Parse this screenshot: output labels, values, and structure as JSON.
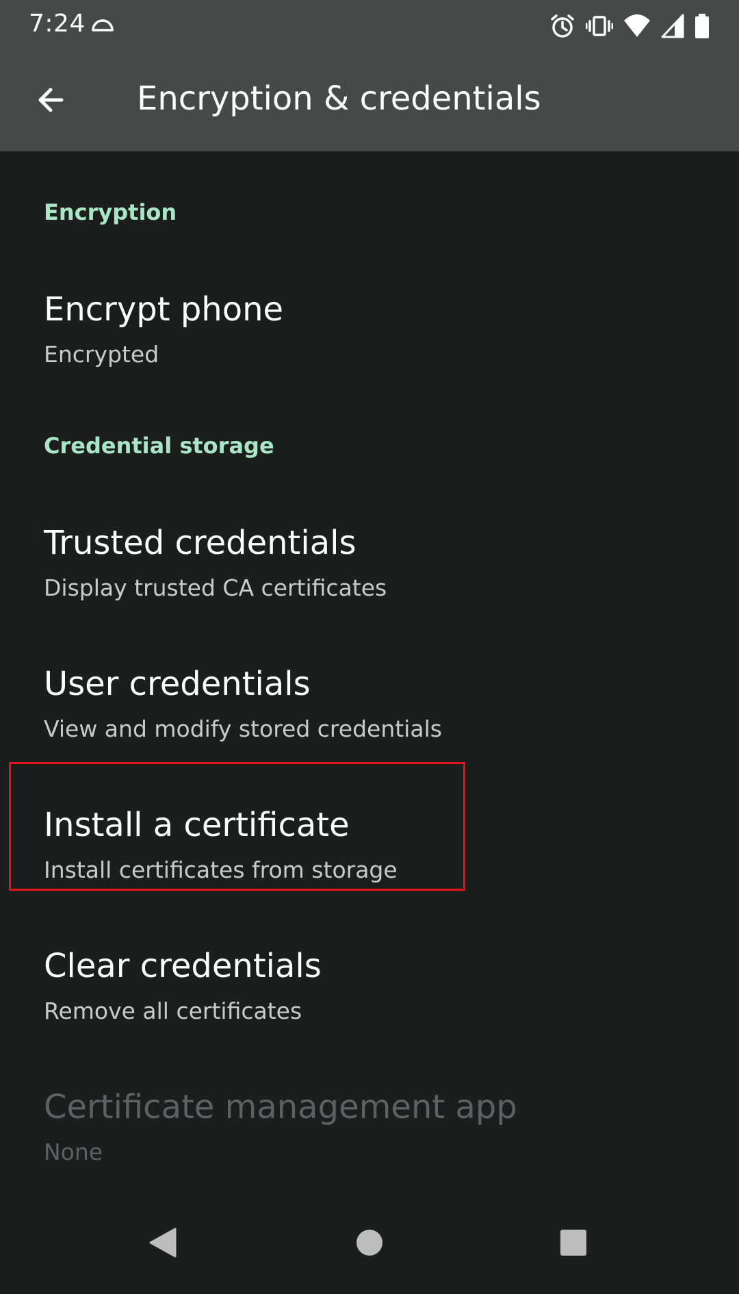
{
  "status_bar": {
    "time": "7:24",
    "icons": [
      "cloud-icon",
      "alarm-icon",
      "vibrate-icon",
      "wifi-icon",
      "signal-icon",
      "battery-icon"
    ]
  },
  "app_bar": {
    "title": "Encryption & credentials",
    "back_icon": "arrow-left-icon"
  },
  "sections": {
    "encryption": {
      "header": "Encryption",
      "items": [
        {
          "title": "Encrypt phone",
          "summary": "Encrypted"
        }
      ]
    },
    "credential_storage": {
      "header": "Credential storage",
      "items": [
        {
          "title": "Trusted credentials",
          "summary": "Display trusted CA certificates"
        },
        {
          "title": "User credentials",
          "summary": "View and modify stored credentials"
        },
        {
          "title": "Install a certificate",
          "summary": "Install certificates from storage"
        },
        {
          "title": "Clear credentials",
          "summary": "Remove all certificates"
        },
        {
          "title": "Certificate management app",
          "summary": "None",
          "disabled": true
        }
      ]
    }
  },
  "highlight": {
    "target": "Install a certificate",
    "color": "#e0141e"
  },
  "nav_bar": {
    "icons": [
      "back-triangle-icon",
      "home-circle-icon",
      "recents-square-icon"
    ]
  },
  "colors": {
    "app_bar_bg": "#454a48",
    "content_bg": "#1c1d1d",
    "section_header": "#a8e6c6",
    "summary_text": "#c9cbcb",
    "disabled_text": "#5e6161"
  }
}
